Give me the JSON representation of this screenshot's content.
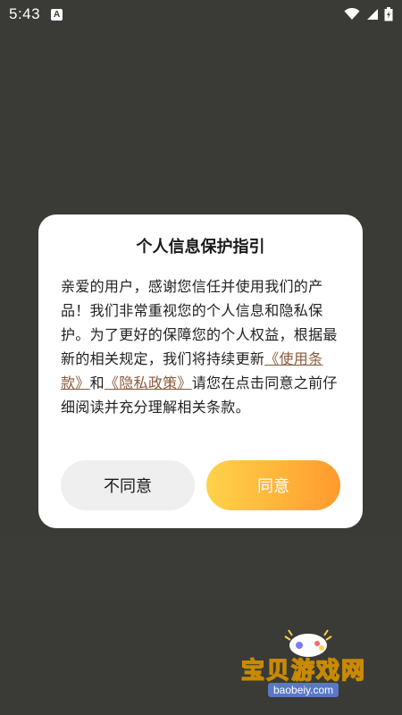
{
  "status_bar": {
    "time": "5:43",
    "notification_letter": "A"
  },
  "dialog": {
    "title": "个人信息保护指引",
    "body_part1": "亲爱的用户，感谢您信任并使用我们的产品！我们非常重视您的个人信息和隐私保护。为了更好的保障您的个人权益，根据最新的相关规定，我们将持续更新",
    "terms_link": "《使用条款》",
    "connector": "和",
    "privacy_link": "《隐私政策》",
    "body_part2": "请您在点击同意之前仔细阅读并充分理解相关条款。",
    "disagree_label": "不同意",
    "agree_label": "同意"
  },
  "watermark": {
    "text": "宝贝游戏网",
    "url": "baobeiy.com"
  },
  "colors": {
    "overlay": "#3a3a37",
    "link": "#8a5a3c",
    "agree_gradient_start": "#ffd24a",
    "agree_gradient_end": "#ff9a2e"
  }
}
